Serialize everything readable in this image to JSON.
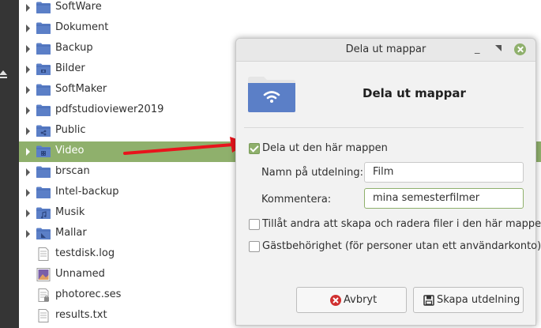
{
  "file_tree": {
    "items": [
      {
        "name": "SoftWare",
        "kind": "folder",
        "overlay": "",
        "selected": false
      },
      {
        "name": "Dokument",
        "kind": "folder",
        "overlay": "",
        "selected": false
      },
      {
        "name": "Backup",
        "kind": "folder",
        "overlay": "",
        "selected": false
      },
      {
        "name": "Bilder",
        "kind": "folder",
        "overlay": "camera",
        "selected": false
      },
      {
        "name": "SoftMaker",
        "kind": "folder",
        "overlay": "",
        "selected": false
      },
      {
        "name": "pdfstudioviewer2019",
        "kind": "folder",
        "overlay": "",
        "selected": false
      },
      {
        "name": "Public",
        "kind": "folder",
        "overlay": "share",
        "selected": false
      },
      {
        "name": "Video",
        "kind": "folder",
        "overlay": "film",
        "selected": true
      },
      {
        "name": "brscan",
        "kind": "folder",
        "overlay": "",
        "selected": false
      },
      {
        "name": "Intel-backup",
        "kind": "folder",
        "overlay": "",
        "selected": false
      },
      {
        "name": "Musik",
        "kind": "folder",
        "overlay": "music",
        "selected": false
      },
      {
        "name": "Mallar",
        "kind": "folder",
        "overlay": "template",
        "selected": false
      },
      {
        "name": "testdisk.log",
        "kind": "text-file",
        "overlay": "",
        "selected": false
      },
      {
        "name": "Unnamed",
        "kind": "image-file",
        "overlay": "",
        "selected": false
      },
      {
        "name": "photorec.ses",
        "kind": "locked-file",
        "overlay": "",
        "selected": false
      },
      {
        "name": "results.txt",
        "kind": "text-file",
        "overlay": "",
        "selected": false
      }
    ]
  },
  "dialog": {
    "title": "Dela ut mappar",
    "heading": "Dela ut mappar",
    "share_checkbox": {
      "label": "Dela ut den här mappen",
      "checked": true
    },
    "share_name": {
      "label": "Namn på utdelning:",
      "value": "Film"
    },
    "comment": {
      "label": "Kommentera:",
      "value": "mina semesterfilmer"
    },
    "allow_others": {
      "label": "Tillåt andra att skapa och radera filer i den här mappen",
      "checked": false
    },
    "guest_access": {
      "label": "Gästbehörighet (för personer utan ett användarkonto)",
      "checked": false
    },
    "cancel_button": {
      "label": "Avbryt",
      "icon": "cancel-icon"
    },
    "create_button": {
      "label": "Skapa utdelning",
      "icon": "save-icon"
    }
  },
  "colors": {
    "accent": "#8fb06c",
    "folder": "#5b7fc7",
    "annotation_arrow": "#e8141c",
    "sidebar": "#353535"
  }
}
